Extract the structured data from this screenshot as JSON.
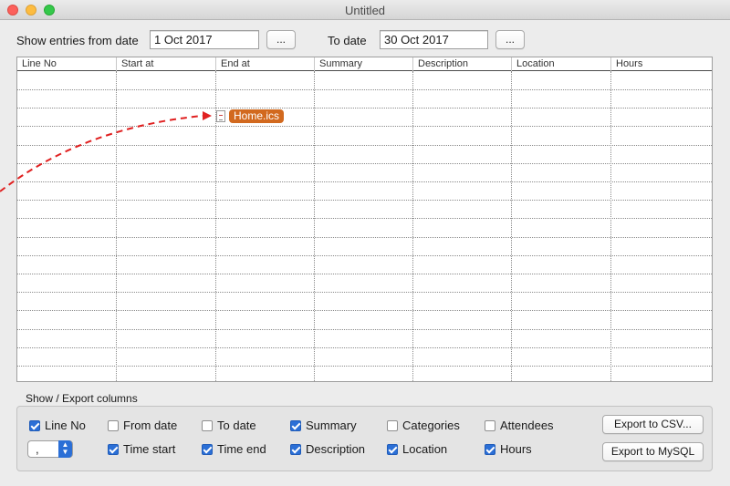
{
  "window": {
    "title": "Untitled"
  },
  "filter": {
    "from_label": "Show entries from date",
    "from_value": "1 Oct 2017",
    "from_button": "...",
    "to_label": "To date",
    "to_value": "30 Oct 2017",
    "to_button": "..."
  },
  "table": {
    "columns": [
      "Line No",
      "Start at",
      "End at",
      "Summary",
      "Description",
      "Location",
      "Hours"
    ],
    "rows": []
  },
  "drag": {
    "file_name": "Home.ics",
    "arrow_color": "#e02020"
  },
  "export": {
    "group_label": "Show / Export columns",
    "checkboxes": [
      {
        "label": "Line No",
        "checked": true
      },
      {
        "label": "From date",
        "checked": false
      },
      {
        "label": "To date",
        "checked": false
      },
      {
        "label": "Summary",
        "checked": true
      },
      {
        "label": "Categories",
        "checked": false
      },
      {
        "label": "Attendees",
        "checked": false
      },
      {
        "label": "Time start",
        "checked": true
      },
      {
        "label": "Time end",
        "checked": true
      },
      {
        "label": "Description",
        "checked": true
      },
      {
        "label": "Location",
        "checked": true
      },
      {
        "label": "Hours",
        "checked": true
      }
    ],
    "separator_value": ",",
    "csv_button": "Export to CSV...",
    "mysql_button": "Export to MySQL"
  },
  "colors": {
    "accent": "#2b6fd6",
    "file_chip": "#d2691e"
  }
}
